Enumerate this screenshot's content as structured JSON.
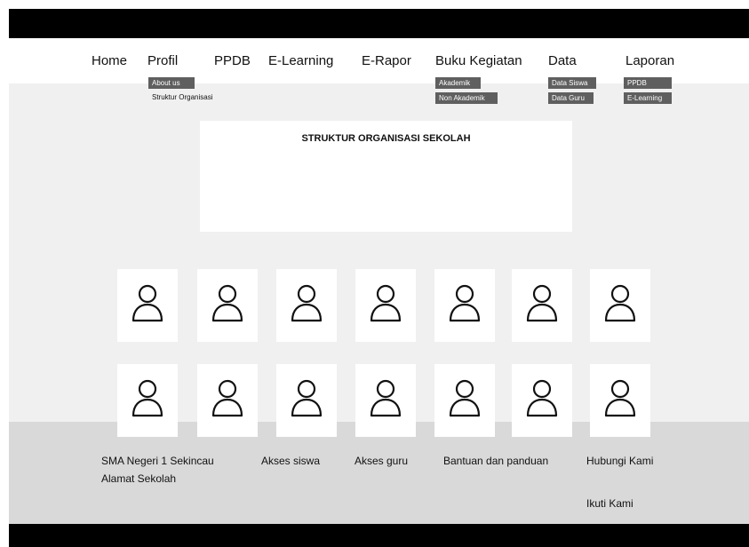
{
  "nav": {
    "items": [
      {
        "label": "Home"
      },
      {
        "label": "Profil"
      },
      {
        "label": "PPDB"
      },
      {
        "label": "E-Learning"
      },
      {
        "label": "E-Rapor"
      },
      {
        "label": "Buku Kegiatan"
      },
      {
        "label": "Data"
      },
      {
        "label": "Laporan"
      }
    ],
    "submenus": {
      "profil": [
        "About us",
        "Struktur Organisasi"
      ],
      "buku_kegiatan": [
        "Akademik",
        "Non Akademik"
      ],
      "data": [
        "Data Siswa",
        "Data Guru"
      ],
      "laporan": [
        "PPDB",
        "E-Learning"
      ]
    }
  },
  "main": {
    "title": "STRUKTUR ORGANISASI SEKOLAH",
    "person_icon": "user-icon"
  },
  "footer": {
    "school_name": "SMA Negeri 1 Sekincau",
    "address": "Alamat Sekolah",
    "links": [
      "Akses siswa",
      "Akses guru",
      "Bantuan dan panduan",
      "Hubungi Kami",
      "Ikuti Kami"
    ]
  }
}
